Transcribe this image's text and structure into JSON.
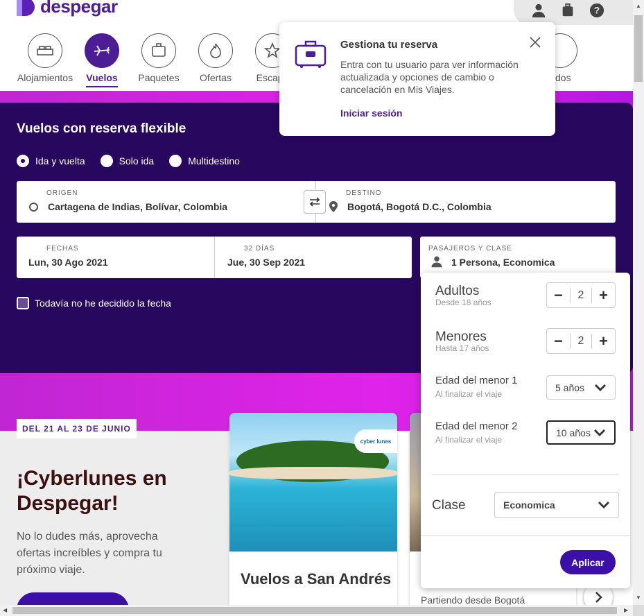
{
  "brand": {
    "name": "despegar"
  },
  "nav": {
    "items": [
      {
        "label": "Alojamientos",
        "icon": "bed-icon"
      },
      {
        "label": "Vuelos",
        "icon": "plane-icon",
        "active": true
      },
      {
        "label": "Paquetes",
        "icon": "suitcase-icon"
      },
      {
        "label": "Ofertas",
        "icon": "fire-icon"
      },
      {
        "label": "Escapa",
        "icon": "star-icon"
      }
    ],
    "hidden_tail": "dos"
  },
  "popover": {
    "title": "Gestiona tu reserva",
    "text": "Entra con tu usuario para ver información actualizada y opciones de cambio o cancelación en Mis Viajes.",
    "link": "Iniciar sesión"
  },
  "search": {
    "title": "Vuelos con reserva flexible",
    "trip_types": [
      "Ida y vuelta",
      "Solo ida",
      "Multidestino"
    ],
    "origin_label": "ORIGEN",
    "origin_value": "Cartagena de Indias, Bolívar, Colombia",
    "destination_label": "DESTINO",
    "destination_value": "Bogotá, Bogotá D.C., Colombia",
    "dates_label": "FECHAS",
    "depart_value": "Lun, 30 Ago 2021",
    "days_label": "32 DÍAS",
    "return_value": "Jue, 30 Sep 2021",
    "pax_label": "PASAJEROS Y CLASE",
    "pax_value": "1 Persona, Economica",
    "undecided": "Todavía no he decidido la fecha"
  },
  "passengers": {
    "adults_title": "Adultos",
    "adults_sub": "Desde 18 años",
    "adults_value": "2",
    "minors_title": "Menores",
    "minors_sub": "Hasta 17 años",
    "minors_value": "2",
    "minor1_label": "Edad del menor 1",
    "minor1_sub": "Al finalizar el viaje",
    "minor1_value": "5 años",
    "minor2_label": "Edad del menor 2",
    "minor2_sub": "Al finalizar el viaje",
    "minor2_value": "10 años",
    "class_label": "Clase",
    "class_value": "Economica",
    "apply": "Aplicar"
  },
  "promo": {
    "badge": "DEL 21 AL 23 DE JUNIO",
    "title": "¡Cyberlunes en Despegar!",
    "text": "No lo dudes más, aprovecha ofertas increíbles y compra tu próximo viaje.",
    "card1_title": "Vuelos a San Andrés",
    "card1_tag": "cyber lunes",
    "card2_sub": "Partiendo desde Bogotá"
  },
  "colors": {
    "brand": "#4c1d95",
    "search_bg": "#28075f",
    "band": "#e023ea",
    "button": "#3b0fa8"
  }
}
